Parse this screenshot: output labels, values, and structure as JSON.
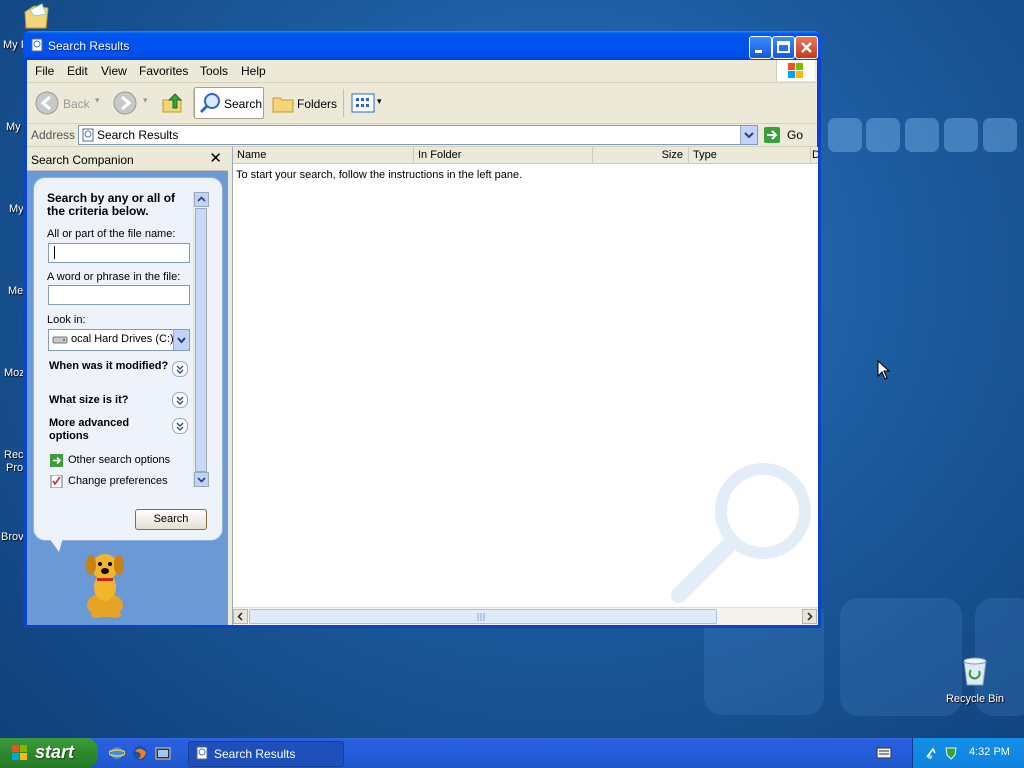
{
  "desktop": {
    "icons": [
      {
        "label": "My I"
      },
      {
        "label": "My"
      },
      {
        "label": "My"
      },
      {
        "label": "Me"
      },
      {
        "label": "Moz"
      },
      {
        "label": "Rec"
      },
      {
        "label": "Pro"
      },
      {
        "label": "Brov"
      }
    ],
    "recycle_bin": "Recycle Bin"
  },
  "window": {
    "title": "Search Results",
    "menu": [
      "File",
      "Edit",
      "View",
      "Favorites",
      "Tools",
      "Help"
    ],
    "toolbar": {
      "back": "Back",
      "search": "Search",
      "folders": "Folders"
    },
    "address": {
      "label": "Address",
      "value": "Search Results",
      "go": "Go"
    }
  },
  "search_companion": {
    "title": "Search Companion",
    "close": "✕",
    "heading": "Search by any or all of the criteria below.",
    "file_name_label": "All or part of the file name:",
    "file_name_value": "",
    "phrase_label": "A word or phrase in the file:",
    "phrase_value": "",
    "look_in_label": "Look in:",
    "look_in_value": "ocal Hard Drives (C:)",
    "sections": [
      {
        "label": "When was it modified?"
      },
      {
        "label": "What size is it?"
      },
      {
        "label": "More advanced options"
      }
    ],
    "links": [
      {
        "label": "Other search options",
        "icon": "green-arrow-icon"
      },
      {
        "label": "Change preferences",
        "icon": "checklist-icon"
      }
    ],
    "search_button": "Search"
  },
  "results": {
    "columns": [
      "Name",
      "In Folder",
      "Size",
      "Type",
      "D"
    ],
    "message": "To start your search, follow the instructions in the left pane."
  },
  "taskbar": {
    "start": "start",
    "task": "Search Results",
    "clock": "4:32 PM"
  },
  "colors": {
    "title_blue": "#0053ee",
    "start_green": "#2e8a2e",
    "pane_blue": "#6b99d6"
  }
}
